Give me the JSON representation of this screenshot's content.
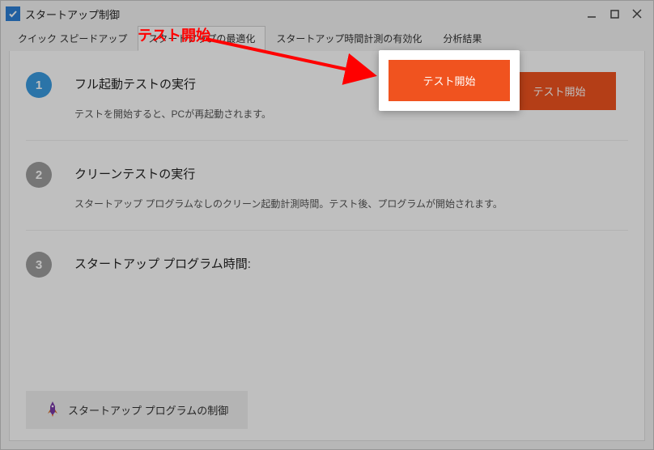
{
  "window": {
    "title": "スタートアップ制御"
  },
  "tabs": {
    "quick_speedup": "クイック スピードアップ",
    "startup_optimize": "スタートアップの最適化",
    "startup_timing_enable": "スタートアップ時間計測の有効化",
    "analysis_results": "分析結果"
  },
  "steps": {
    "s1": {
      "num": "1",
      "title": "フル起動テストの実行",
      "desc": "テストを開始すると、PCが再起動されます。",
      "action": "テスト開始"
    },
    "s2": {
      "num": "2",
      "title": "クリーンテストの実行",
      "desc": "スタートアップ プログラムなしのクリーン起動計測時間。テスト後、プログラムが開始されます。"
    },
    "s3": {
      "num": "3",
      "title": "スタートアップ プログラム時間:"
    }
  },
  "footer": {
    "control_startup_programs": "スタートアップ プログラムの制御"
  },
  "annotation": {
    "label": "テスト開始",
    "button_label": "テスト開始"
  }
}
